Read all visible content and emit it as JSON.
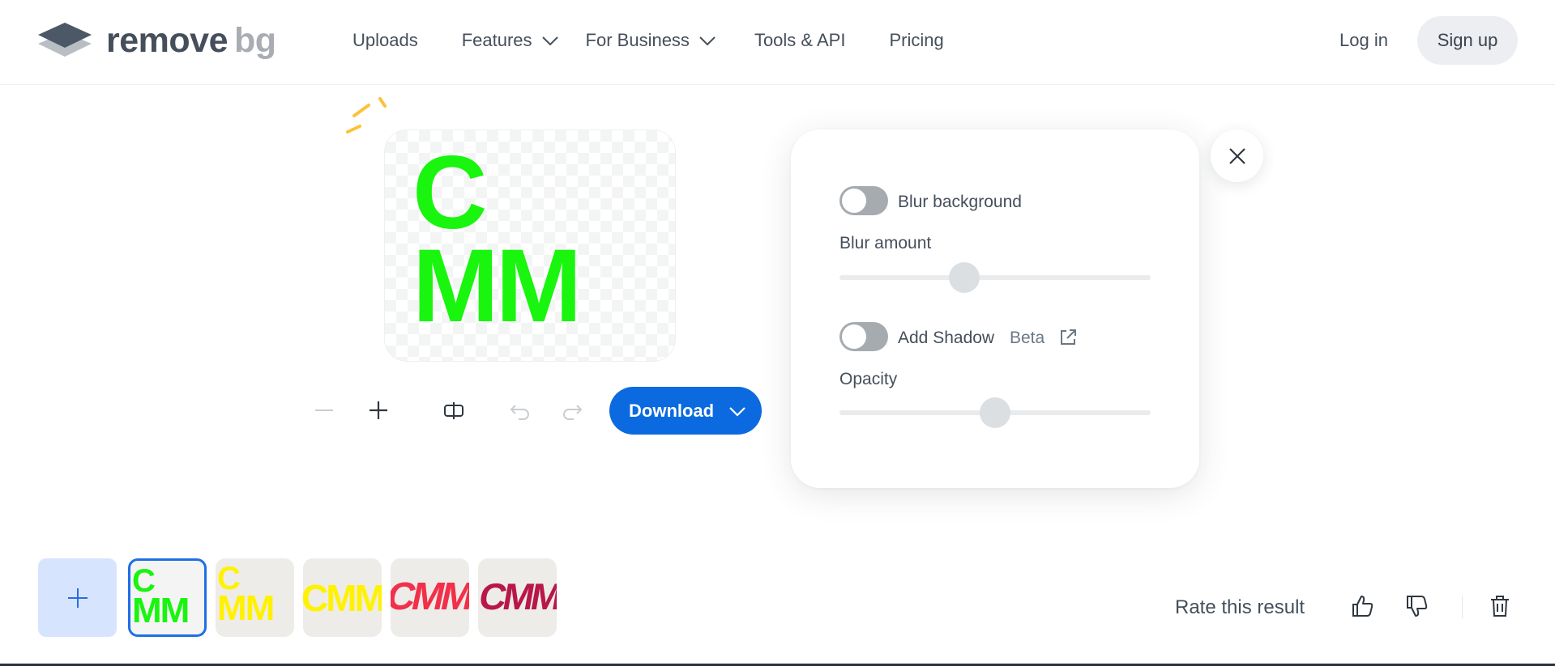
{
  "brand": {
    "logo_text_1": "remove",
    "logo_text_2": "bg"
  },
  "nav": {
    "uploads": "Uploads",
    "features": "Features",
    "for_business": "For Business",
    "tools_api": "Tools & API",
    "pricing": "Pricing"
  },
  "auth": {
    "login": "Log in",
    "signup": "Sign up"
  },
  "preview": {
    "line1": "C",
    "line2": "MM"
  },
  "toolbar": {
    "download_label": "Download"
  },
  "settings": {
    "blur_background_label": "Blur background",
    "blur_background_enabled": false,
    "blur_amount_label": "Blur amount",
    "blur_amount_value": 0.4,
    "add_shadow_label": "Add Shadow",
    "add_shadow_enabled": false,
    "beta_label": "Beta",
    "opacity_label": "Opacity",
    "opacity_value": 0.5
  },
  "thumbnails": [
    {
      "line1": "C",
      "line2": "MM",
      "color": "#19f50e",
      "selected": true
    },
    {
      "line1": "C",
      "line2": "MM",
      "color": "#fff200",
      "selected": false
    },
    {
      "line1": "CMM",
      "color": "#fff200",
      "selected": false
    },
    {
      "line1": "CMM",
      "color": "#f2304a",
      "selected": false
    },
    {
      "line1": "CMM",
      "color": "#b8174a",
      "selected": false
    }
  ],
  "rating": {
    "label": "Rate this result"
  },
  "colors": {
    "accent": "#0b6adf",
    "text": "#454f5b",
    "brand_gray": "#a9adb3"
  }
}
